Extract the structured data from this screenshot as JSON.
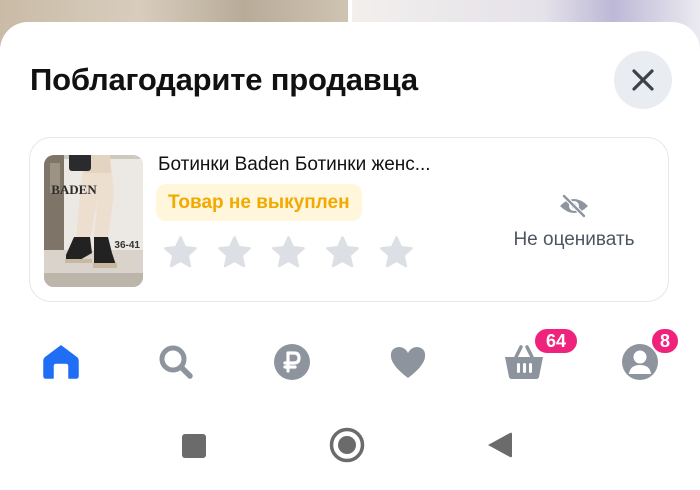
{
  "sheet": {
    "title": "Поблагодарите продавца"
  },
  "product": {
    "name": "Ботинки Baden Ботинки женс...",
    "thumbnail": {
      "brand": "BADEN",
      "sizes": "36-41"
    },
    "status_badge": "Товар не выкуплен",
    "rating": {
      "max": 5,
      "value": 0
    },
    "skip_label": "Не оценивать"
  },
  "tabbar": {
    "items": [
      {
        "icon": "home-icon",
        "active": true
      },
      {
        "icon": "search-icon"
      },
      {
        "icon": "ruble-icon"
      },
      {
        "icon": "heart-icon"
      },
      {
        "icon": "basket-icon",
        "badge": "64"
      },
      {
        "icon": "profile-icon",
        "badge": "8"
      }
    ]
  },
  "system_nav": [
    "recent-apps-icon",
    "home-circle-icon",
    "back-triangle-icon"
  ],
  "colors": {
    "accent_blue": "#1f6ef5",
    "icon_gray": "#8e949e",
    "badge_pink": "#f0237c",
    "status_yellow": "#f2a900",
    "status_bg": "#fff6dc",
    "star_gray": "#dcdfe4"
  }
}
